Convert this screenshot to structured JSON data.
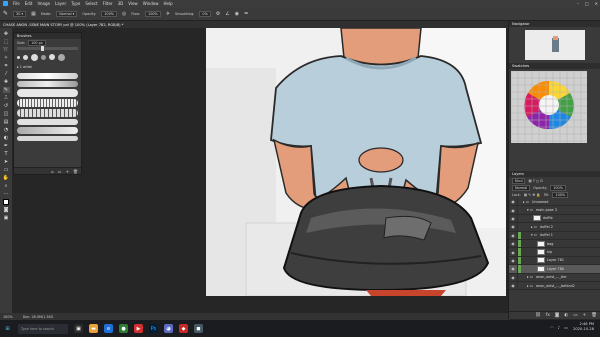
{
  "menu": {
    "items": [
      "File",
      "Edit",
      "Image",
      "Layer",
      "Type",
      "Select",
      "Filter",
      "3D",
      "View",
      "Window",
      "Help"
    ],
    "window_controls": [
      "–",
      "□",
      "✕"
    ]
  },
  "options": {
    "brush_size": "30",
    "mode_label": "Mode:",
    "mode_value": "Normal",
    "opacity_label": "Opacity:",
    "opacity_value": "100%",
    "flow_label": "Flow:",
    "flow_value": "100%",
    "smoothing_label": "Smoothing:",
    "smoothing_value": "0%"
  },
  "doc_tab": {
    "title": "CHASE ANON .SSNE MAIN STORY pnl @ 100% (Layer 782, RGB/8) *"
  },
  "brush_panel": {
    "title": "Brushes",
    "size_label": "Size:",
    "size_value": "100 px",
    "folder_label": "▸  1 artist"
  },
  "status": {
    "zoom": "100%",
    "doc": "Doc: 28.0M/1.34G"
  },
  "right": {
    "navigator_title": "Navigator",
    "color_title": "Swatches",
    "layers_title": "Layers",
    "layer_kind": "Kind",
    "layer_mode": "Normal",
    "opacity_label": "Opacity:",
    "opacity_value": "100%",
    "lock_label": "Lock:",
    "fill_label": "Fill:",
    "fill_value": "100%",
    "layers": [
      {
        "name": "Unnamed",
        "type": "group",
        "color": "#3a3a3a"
      },
      {
        "name": "main pose 3",
        "type": "group",
        "color": "#3a3a3a"
      },
      {
        "name": "duffle",
        "type": "layer",
        "color": "#3a3a3a"
      },
      {
        "name": "duffel 2",
        "type": "group",
        "color": "#3a3a3a"
      },
      {
        "name": "duffel 1",
        "type": "group",
        "color": "#6aa84f"
      },
      {
        "name": "bag",
        "type": "layer",
        "color": "#6aa84f"
      },
      {
        "name": "hip",
        "type": "layer",
        "color": "#6aa84f"
      },
      {
        "name": "Layer 781",
        "type": "layer",
        "color": "#6aa84f"
      },
      {
        "name": "Layer 780",
        "type": "layer",
        "color": "#6aa84f",
        "selected": true
      },
      {
        "name": "anon_wrist_..._tier",
        "type": "group",
        "color": "#3a3a3a"
      },
      {
        "name": "anon_wrist_..._behind2",
        "type": "group",
        "color": "#3a3a3a"
      }
    ]
  },
  "taskbar": {
    "search_placeholder": "Type here to search",
    "time": "2:46 PM",
    "date": "2020-10-28"
  },
  "colors": {
    "accent": "#31a8ff",
    "canvas_bg": "#f2f2f2",
    "shirt": "#b9cedb",
    "skin": "#e39d7a",
    "bag": "#3e3e3e"
  }
}
